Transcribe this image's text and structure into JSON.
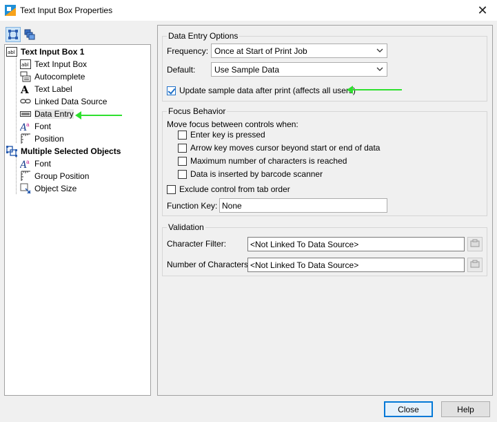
{
  "window": {
    "title": "Text Input Box Properties",
    "close_glyph": "✕"
  },
  "toolbar": {
    "icons": [
      "single-object-icon",
      "multiple-objects-icon"
    ]
  },
  "tree": {
    "root1": {
      "label": "Text Input Box 1",
      "icon": "text-input-icon"
    },
    "root1_items": [
      {
        "label": "Text Input Box",
        "icon": "abl-icon"
      },
      {
        "label": "Autocomplete",
        "icon": "autocomplete-icon"
      },
      {
        "label": "Text Label",
        "icon": "text-label-icon"
      },
      {
        "label": "Linked Data Source",
        "icon": "link-icon"
      },
      {
        "label": "Data Entry",
        "icon": "data-entry-icon"
      },
      {
        "label": "Font",
        "icon": "font-icon"
      },
      {
        "label": "Position",
        "icon": "position-icon"
      }
    ],
    "root2": {
      "label": "Multiple Selected Objects",
      "icon": "multiple-objects-icon"
    },
    "root2_items": [
      {
        "label": "Font",
        "icon": "font-icon"
      },
      {
        "label": "Group Position",
        "icon": "group-position-icon"
      },
      {
        "label": "Object Size",
        "icon": "object-size-icon"
      }
    ]
  },
  "data_entry": {
    "title": "Data Entry Options",
    "frequency_label": "Frequency:",
    "frequency_value": "Once at Start of Print Job",
    "default_label": "Default:",
    "default_value": "Use Sample Data",
    "update_label": "Update sample data after print (affects all users)",
    "update_checked": true
  },
  "focus": {
    "title": "Focus Behavior",
    "move_label": "Move focus between controls when:",
    "options": [
      "Enter key is pressed",
      "Arrow key moves cursor beyond start or end of data",
      "Maximum number of characters is reached",
      "Data is inserted by barcode scanner"
    ],
    "exclude_label": "Exclude control from tab order",
    "function_key_label": "Function Key:",
    "function_key_value": "None"
  },
  "validation": {
    "title": "Validation",
    "char_filter_label": "Character Filter:",
    "char_filter_value": "<Not Linked To Data Source>",
    "num_chars_label": "Number of Characters:",
    "num_chars_value": "<Not Linked To Data Source>"
  },
  "buttons": {
    "close": "Close",
    "help": "Help"
  },
  "colors": {
    "annotation_arrow": "#2ee02e",
    "accent": "#0078d7"
  }
}
